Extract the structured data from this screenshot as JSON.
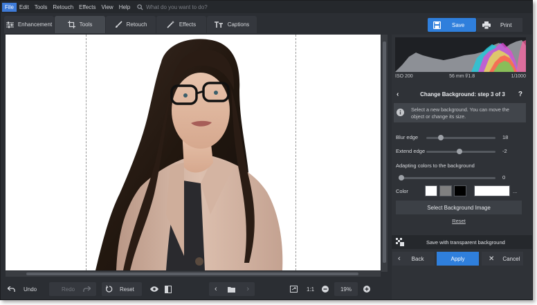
{
  "menu": {
    "items": [
      "File",
      "Edit",
      "Tools",
      "Retouch",
      "Effects",
      "View",
      "Help"
    ],
    "search_placeholder": "What do you want to do?"
  },
  "tabs": [
    {
      "label": "Enhancement",
      "icon": "sliders-icon"
    },
    {
      "label": "Tools",
      "icon": "crop-icon"
    },
    {
      "label": "Retouch",
      "icon": "brush-icon"
    },
    {
      "label": "Effects",
      "icon": "magic-wand-icon"
    },
    {
      "label": "Captions",
      "icon": "text-icon"
    }
  ],
  "toolbar": {
    "save_label": "Save",
    "print_label": "Print"
  },
  "histogram": {
    "iso": "ISO 200",
    "lens": "56 mm f/1.8",
    "shutter": "1/1000"
  },
  "panel": {
    "title": "Change Background: step 3 of 3",
    "help": "?",
    "info_line1": "Select a new background. You can move the",
    "info_line2": "object or change its size.",
    "blur_edge": {
      "label": "Blur edge",
      "value": "18",
      "level": 0.18
    },
    "extend_edge": {
      "label": "Extend edge",
      "value": "-2",
      "level": 0.48
    },
    "adapting": {
      "label": "Adapting colors to the background",
      "value": "0",
      "level": 0
    },
    "color": {
      "label": "Color",
      "swatches": [
        "#ffffff",
        "#808080",
        "#000000"
      ],
      "selected": "#ffffff",
      "more": "..."
    },
    "select_bg_label": "Select Background Image",
    "reset_label": "Reset",
    "save_transparent_label": "Save with transparent background",
    "back_label": "Back",
    "apply_label": "Apply",
    "cancel_label": "Cancel"
  },
  "bottom": {
    "undo_label": "Undo",
    "redo_label": "Redo",
    "reset_label": "Reset",
    "fit_label": "1:1",
    "zoom": "19%"
  },
  "colors": {
    "accent": "#2f7fdc",
    "bg": "#2b2e33",
    "panel": "#2f3237"
  }
}
